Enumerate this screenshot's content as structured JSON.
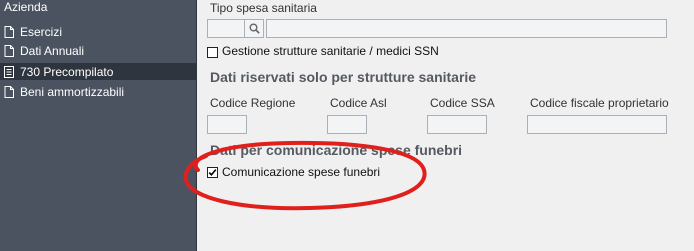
{
  "sidebar": {
    "title": "Azienda",
    "items": [
      {
        "label": "Esercizi",
        "active": false
      },
      {
        "label": "Dati Annuali",
        "active": false
      },
      {
        "label": "730 Precompilato",
        "active": true
      },
      {
        "label": "Beni ammortizzabili",
        "active": false
      }
    ]
  },
  "form": {
    "tipo_spesa_label": "Tipo spesa sanitaria",
    "tipo_spesa_code": "",
    "tipo_spesa_desc": "",
    "gestione_label": "Gestione strutture sanitarie / medici SSN",
    "gestione_checked": false,
    "section_riservati": "Dati riservati solo per strutture sanitarie",
    "codice_regione_label": "Codice Regione",
    "codice_asl_label": "Codice Asl",
    "codice_ssa_label": "Codice SSA",
    "codice_fiscale_label": "Codice fiscale proprietario",
    "section_funebri": "Dati per comunicazione spese funebri",
    "comunicazione_label": "Comunicazione spese funebri",
    "comunicazione_checked": true
  },
  "annotation": {
    "color": "#e0201c",
    "icon": "circle-highlight"
  }
}
